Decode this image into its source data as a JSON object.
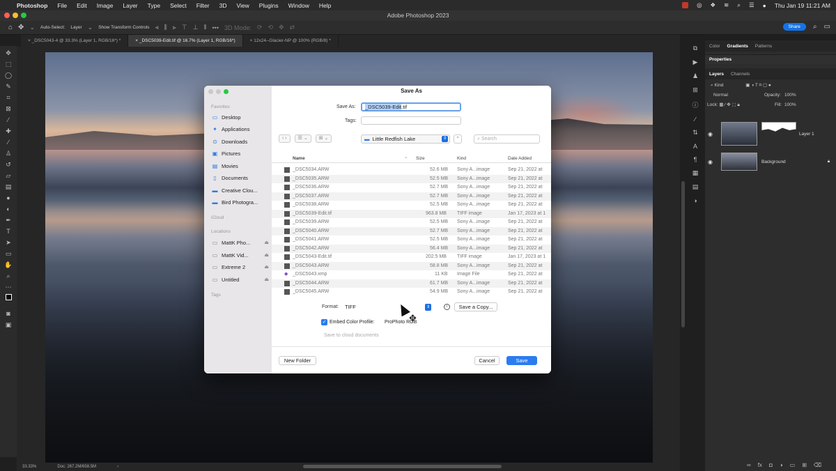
{
  "menubar": {
    "app": "Photoshop",
    "items": [
      "File",
      "Edit",
      "Image",
      "Layer",
      "Type",
      "Select",
      "Filter",
      "3D",
      "View",
      "Plugins",
      "Window",
      "Help"
    ],
    "clock": "Thu Jan 19  11:21 AM"
  },
  "window": {
    "title": "Adobe Photoshop 2023"
  },
  "options": {
    "auto_select": "Auto-Select:",
    "auto_select_value": "Layer",
    "show_transform": "Show Transform Controls",
    "mode3d": "3D Mode:",
    "share": "Share"
  },
  "doc_tabs": [
    "_DSC5043-4 @ 33.3% (Layer 1, RGB/16*) *",
    "_DSC5039-Edit.tif @ 16.7% (Layer 1, RGB/16*)",
    "12x24--Glacier-NP @ 100% (RGB/8) *"
  ],
  "status": {
    "zoom": "33.33%",
    "doc": "Doc: 267.2M/658.5M"
  },
  "panels": {
    "top_tabs": [
      "Color",
      "Gradients",
      "Patterns"
    ],
    "properties": "Properties",
    "layer_tabs": [
      "Layers",
      "Channels"
    ],
    "kind": "Kind",
    "blend": "Normal",
    "opacity_label": "Opacity:",
    "opacity": "100%",
    "lock_label": "Lock:",
    "fill_label": "Fill:",
    "fill": "100%",
    "layers": [
      {
        "name": "Layer 1"
      },
      {
        "name": "Background"
      }
    ]
  },
  "dialog": {
    "title": "Save As",
    "save_as_label": "Save As:",
    "filename_selected": "_DSC5039-Edit",
    "filename_ext": ".tif",
    "tags_label": "Tags:",
    "folder": "Little Redfish Lake",
    "search_placeholder": "Search",
    "sidebar": {
      "favorites_header": "Favorites",
      "favorites": [
        "Desktop",
        "Applications",
        "Downloads",
        "Pictures",
        "Movies",
        "Documents",
        "Creative Clou...",
        "Bird Photogra..."
      ],
      "icloud_header": "iCloud",
      "locations_header": "Locations",
      "locations": [
        "MattK Pho...",
        "MattK Vid...",
        "Extreme 2",
        "Untitled"
      ],
      "tags_header": "Tags"
    },
    "columns": {
      "name": "Name",
      "size": "Size",
      "kind": "Kind",
      "date": "Date Added"
    },
    "files": [
      {
        "name": "_DSC5034.ARW",
        "size": "52.6 MB",
        "kind": "Sony A...image",
        "date": "Sep 21, 2022 at"
      },
      {
        "name": "_DSC5035.ARW",
        "size": "52.5 MB",
        "kind": "Sony A...image",
        "date": "Sep 21, 2022 at"
      },
      {
        "name": "_DSC5036.ARW",
        "size": "52.7 MB",
        "kind": "Sony A...image",
        "date": "Sep 21, 2022 at"
      },
      {
        "name": "_DSC5037.ARW",
        "size": "52.7 MB",
        "kind": "Sony A...image",
        "date": "Sep 21, 2022 at"
      },
      {
        "name": "_DSC5038.ARW",
        "size": "52.5 MB",
        "kind": "Sony A...image",
        "date": "Sep 21, 2022 at"
      },
      {
        "name": "_DSC5039-Edit.tif",
        "size": "963.8 MB",
        "kind": "TIFF image",
        "date": "Jan 17, 2023 at 1"
      },
      {
        "name": "_DSC5039.ARW",
        "size": "52.5 MB",
        "kind": "Sony A...image",
        "date": "Sep 21, 2022 at"
      },
      {
        "name": "_DSC5040.ARW",
        "size": "52.7 MB",
        "kind": "Sony A...image",
        "date": "Sep 21, 2022 at"
      },
      {
        "name": "_DSC5041.ARW",
        "size": "52.5 MB",
        "kind": "Sony A...image",
        "date": "Sep 21, 2022 at"
      },
      {
        "name": "_DSC5042.ARW",
        "size": "56.4 MB",
        "kind": "Sony A...image",
        "date": "Sep 21, 2022 at"
      },
      {
        "name": "_DSC5043-Edit.tif",
        "size": "202.5 MB",
        "kind": "TIFF image",
        "date": "Jan 17, 2023 at 1"
      },
      {
        "name": "_DSC5043.ARW",
        "size": "58.8 MB",
        "kind": "Sony A...image",
        "date": "Sep 21, 2022 at"
      },
      {
        "name": "_DSC5043.xmp",
        "size": "11 KB",
        "kind": "Image File",
        "date": "Sep 21, 2022 at"
      },
      {
        "name": "_DSC5044.ARW",
        "size": "61.7 MB",
        "kind": "Sony A...image",
        "date": "Sep 21, 2022 at"
      },
      {
        "name": "_DSC5045.ARW",
        "size": "54.9 MB",
        "kind": "Sony A...image",
        "date": "Sep 21, 2022 at"
      }
    ],
    "format_label": "Format:",
    "format_value": "TIFF",
    "save_copy": "Save a Copy...",
    "embed_label": "Embed Color Profile:",
    "embed_value": "ProPhoto RGB",
    "cloud": "Save to cloud documents",
    "new_folder": "New Folder",
    "cancel": "Cancel",
    "save": "Save"
  }
}
